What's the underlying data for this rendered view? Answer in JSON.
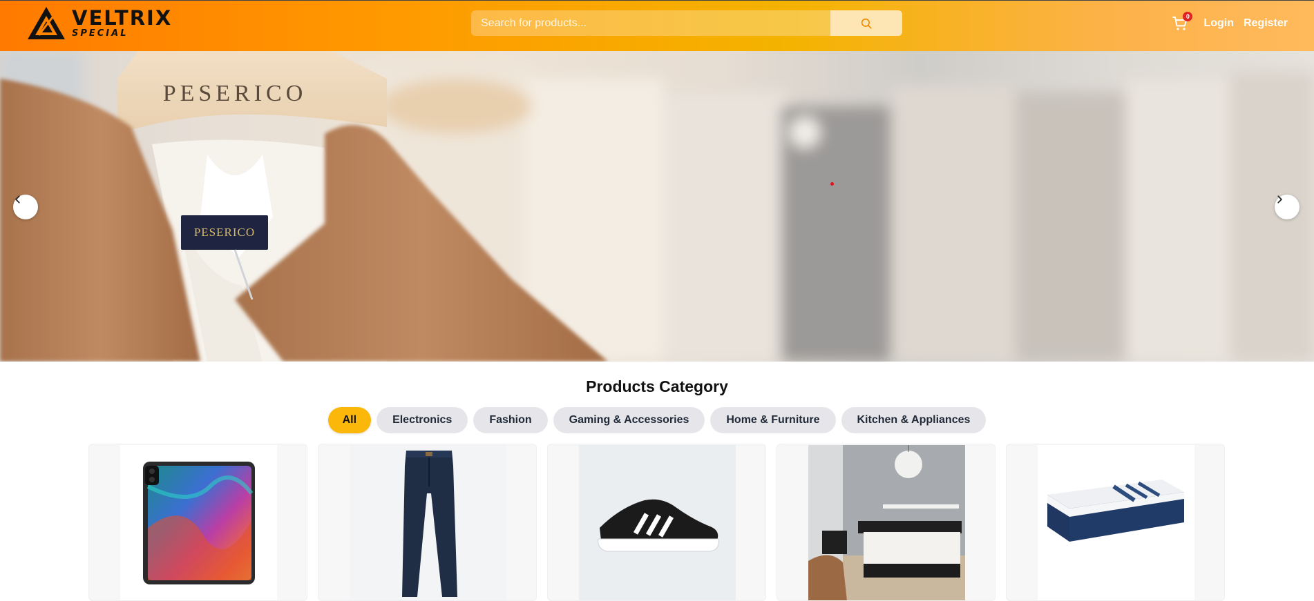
{
  "header": {
    "logo_main": "VELTRIX",
    "logo_sub": "SPECIAL",
    "search_placeholder": "Search for products...",
    "cart_count": "0",
    "login_label": "Login",
    "register_label": "Register",
    "icons": {
      "search": "search-icon",
      "cart": "cart-icon"
    }
  },
  "hero": {
    "prev_icon": "chevron-left-icon",
    "next_icon": "chevron-right-icon",
    "hanger_text": "PESERICO",
    "label_text": "PESERICO"
  },
  "category": {
    "title": "Products Category",
    "chips": [
      "All",
      "Electronics",
      "Fashion",
      "Gaming & Accessories",
      "Home & Furniture",
      "Kitchen & Appliances"
    ],
    "active": "All"
  },
  "products": [
    {
      "image": "tablet-image"
    },
    {
      "image": "jeans-image"
    },
    {
      "image": "sneaker-image"
    },
    {
      "image": "bedroom-image"
    },
    {
      "image": "mattress-image"
    }
  ],
  "colors": {
    "accent": "#fbb80a",
    "brand_orange": "#ff7a00",
    "badge": "#e02424"
  }
}
